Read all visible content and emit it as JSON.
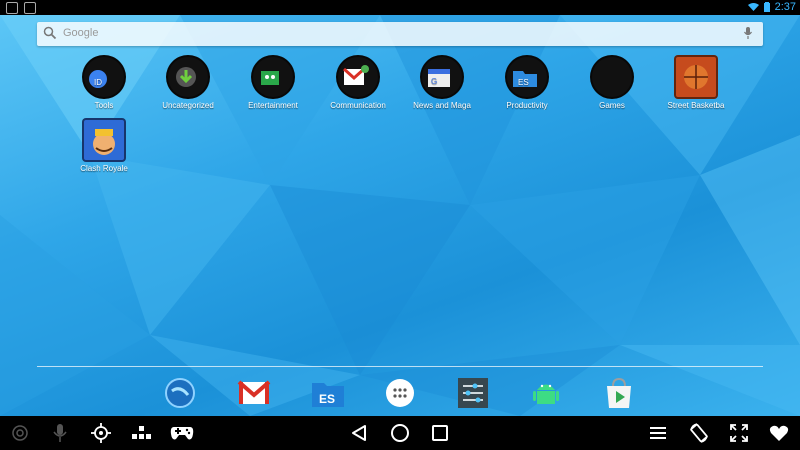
{
  "status_bar": {
    "time": "2:37",
    "left_icons": [
      "notification-icon",
      "notification-icon"
    ],
    "right_icons": [
      "wifi-icon",
      "battery-icon"
    ]
  },
  "search": {
    "placeholder": "Google"
  },
  "apps": [
    {
      "label": "Tools",
      "icon": "tools-folder-icon"
    },
    {
      "label": "Uncategorized",
      "icon": "download-folder-icon"
    },
    {
      "label": "Entertainment",
      "icon": "entertainment-folder-icon"
    },
    {
      "label": "Communication",
      "icon": "gmail-folder-icon"
    },
    {
      "label": "News and Maga",
      "icon": "news-folder-icon"
    },
    {
      "label": "Productivity",
      "icon": "es-file-folder-icon"
    },
    {
      "label": "Games",
      "icon": "games-folder-icon"
    },
    {
      "label": "Street Basketba",
      "icon": "basketball-app-icon"
    },
    {
      "label": "Clash Royale",
      "icon": "clash-royale-app-icon"
    }
  ],
  "dock": [
    "browser-icon",
    "gmail-icon",
    "es-file-explorer-icon",
    "app-drawer-icon",
    "settings-icon",
    "android-icon",
    "play-store-icon"
  ],
  "nav_bar": {
    "left": [
      "camera-icon",
      "microphone-icon",
      "target-icon",
      "keymap-icon",
      "gamepad-icon"
    ],
    "center": [
      "back-icon",
      "home-icon",
      "recents-icon"
    ],
    "right": [
      "menu-icon",
      "rotate-icon",
      "fullscreen-icon",
      "favorite-icon"
    ]
  },
  "colors": {
    "wallpaper_light": "#5cc6f6",
    "wallpaper_dark": "#1b91d8",
    "bars": "#000000",
    "time_color": "#39b7ff"
  }
}
